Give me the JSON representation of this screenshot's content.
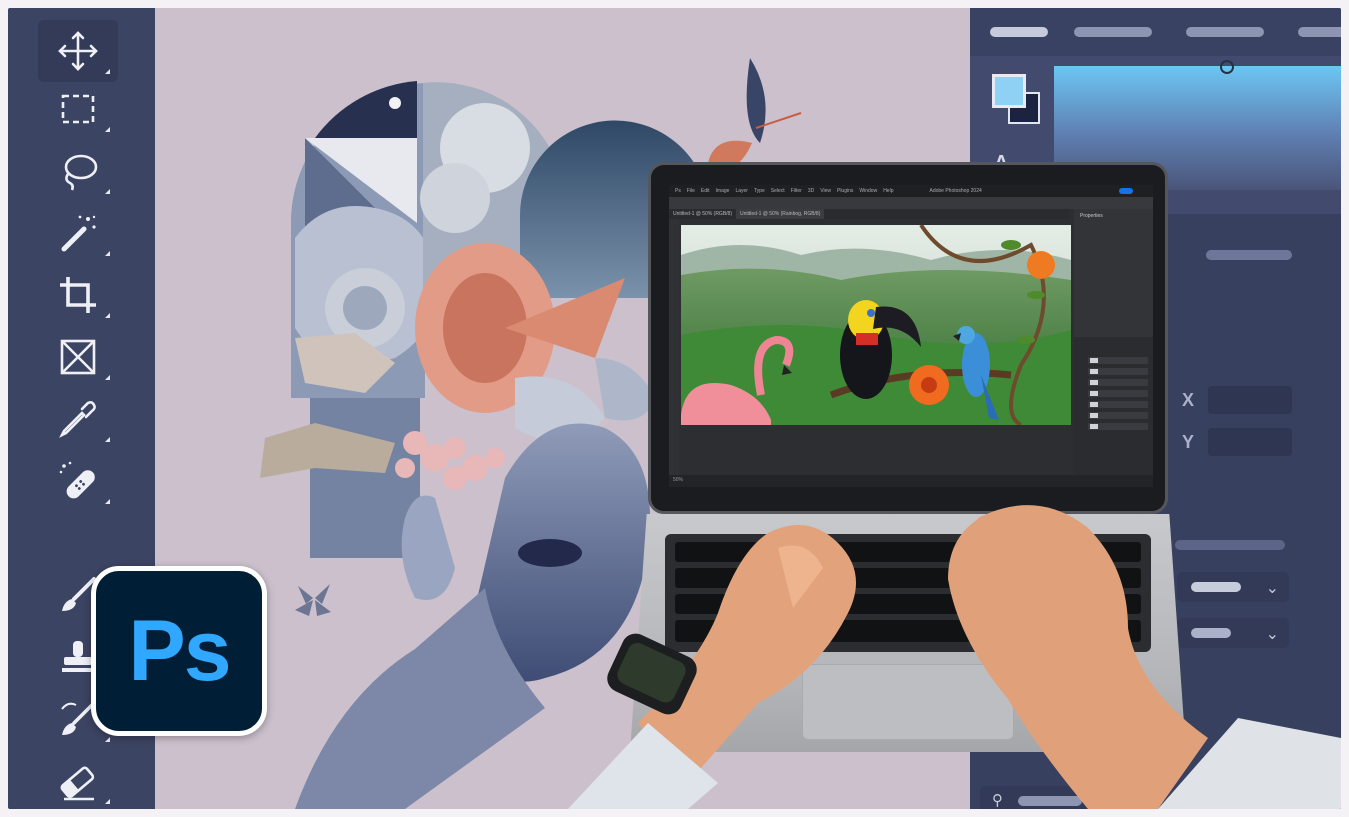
{
  "logo": {
    "text": "Ps",
    "bg_color": "#001e36",
    "text_color": "#31a8ff"
  },
  "toolbar": {
    "active_tool": "move-tool",
    "tools": [
      "move-icon",
      "marquee-icon",
      "lasso-icon",
      "magic-wand-icon",
      "crop-icon",
      "frame-icon",
      "eyedropper-icon",
      "healing-brush-icon",
      "brush-icon",
      "clone-stamp-icon",
      "history-brush-icon",
      "eraser-icon"
    ]
  },
  "properties_panel": {
    "x_label": "X",
    "y_label": "Y",
    "foreground_color": "#8fd0f5",
    "background_color": "#1b2340"
  },
  "laptop_screen": {
    "app_title": "Adobe Photoshop 2024",
    "tabs": [
      "Untitled-1 @ 50% (RGB/8)",
      "Untitled-1 @ 50% (Rainbog, RGB/8)"
    ],
    "menu": [
      "Ps",
      "File",
      "Edit",
      "Image",
      "Layer",
      "Type",
      "Select",
      "Filter",
      "3D",
      "View",
      "Plugins",
      "Window",
      "Help"
    ],
    "props_title": "Properties",
    "status": "50%"
  },
  "colors": {
    "toolbar_bg": "#3c4463",
    "canvas_bg": "#cbc0cc",
    "panel_bg": "#424a6d",
    "accent_blue": "#6cc6f3"
  }
}
